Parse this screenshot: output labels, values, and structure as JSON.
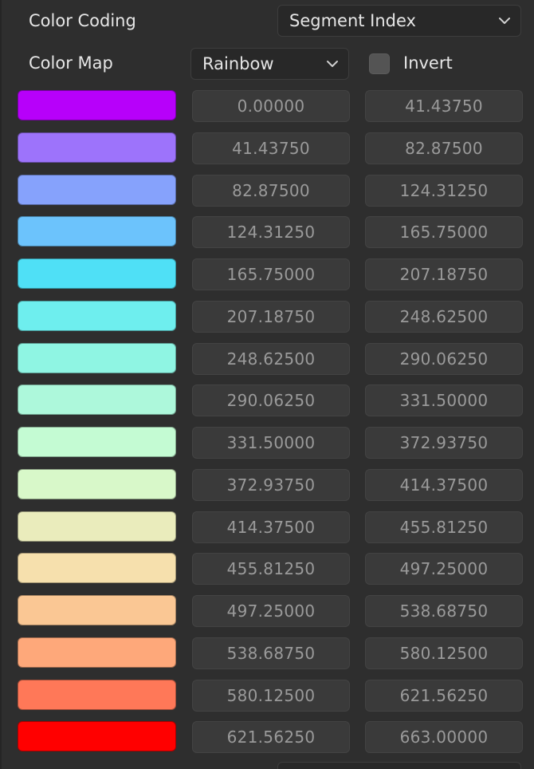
{
  "color_coding": {
    "label": "Color Coding",
    "value": "Segment Index"
  },
  "color_map": {
    "label": "Color Map",
    "value": "Rainbow"
  },
  "invert": {
    "label": "Invert",
    "checked": false
  },
  "ramp": [
    {
      "color": "#b700fa",
      "min": "0.00000",
      "max": "41.43750"
    },
    {
      "color": "#9d73fb",
      "min": "41.43750",
      "max": "82.87500"
    },
    {
      "color": "#86a2fc",
      "min": "82.87500",
      "max": "124.31250"
    },
    {
      "color": "#6cc3fc",
      "min": "124.31250",
      "max": "165.75000"
    },
    {
      "color": "#4fe0f6",
      "min": "165.75000",
      "max": "207.18750"
    },
    {
      "color": "#6eeeee",
      "min": "207.18750",
      "max": "248.62500"
    },
    {
      "color": "#8ff5e3",
      "min": "248.62500",
      "max": "290.06250"
    },
    {
      "color": "#adf8db",
      "min": "290.06250",
      "max": "331.50000"
    },
    {
      "color": "#c4fbd3",
      "min": "331.50000",
      "max": "372.93750"
    },
    {
      "color": "#d8f8c9",
      "min": "372.93750",
      "max": "414.37500"
    },
    {
      "color": "#eaecbc",
      "min": "414.37500",
      "max": "455.81250"
    },
    {
      "color": "#f6e0ad",
      "min": "455.81250",
      "max": "497.25000"
    },
    {
      "color": "#fac794",
      "min": "497.25000",
      "max": "538.68750"
    },
    {
      "color": "#fea87a",
      "min": "538.68750",
      "max": "580.12500"
    },
    {
      "color": "#ff7858",
      "min": "580.12500",
      "max": "621.56250"
    },
    {
      "color": "#ff0000",
      "min": "621.56250",
      "max": "663.00000"
    }
  ]
}
